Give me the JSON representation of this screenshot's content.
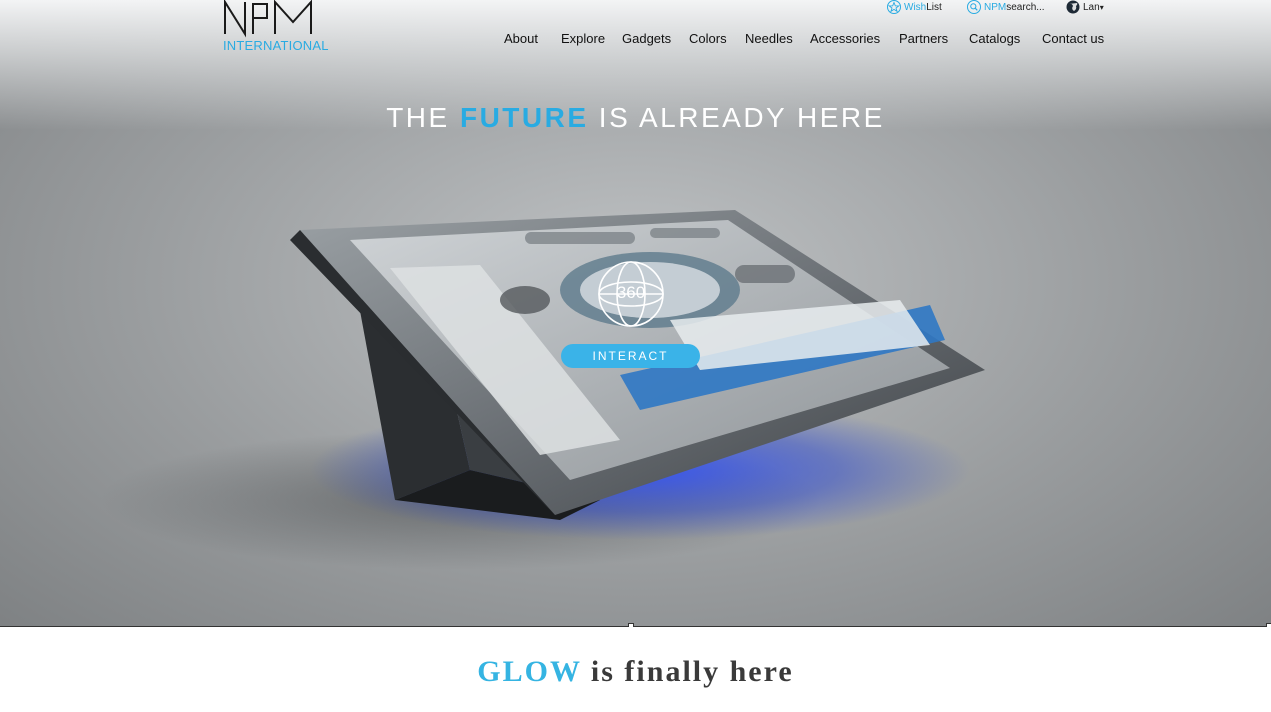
{
  "logo": {
    "mark": "NPM",
    "subtitle": "INTERNATIONAL"
  },
  "utility": {
    "wishlist": {
      "prefix": "Wish",
      "suffix": "List",
      "icon": "star-icon"
    },
    "search": {
      "prefix": "NPM",
      "suffix": "search...",
      "icon": "search-icon"
    },
    "language": {
      "label": "Lan",
      "icon": "globe-icon"
    }
  },
  "nav": {
    "items": [
      "About",
      "Explore",
      "Gadgets",
      "Colors",
      "Needles",
      "Accessories",
      "Partners",
      "Catalogs",
      "Contact us"
    ]
  },
  "hero": {
    "headline_pre": "THE ",
    "headline_accent": "FUTURE",
    "headline_post": " IS ALREADY HERE",
    "badge_text": "360",
    "interact_label": "INTERACT"
  },
  "section": {
    "glow_accent": "GLOW",
    "glow_rest": " is finally here"
  },
  "colors": {
    "accent": "#29abe2",
    "button": "#3ab3e8"
  }
}
